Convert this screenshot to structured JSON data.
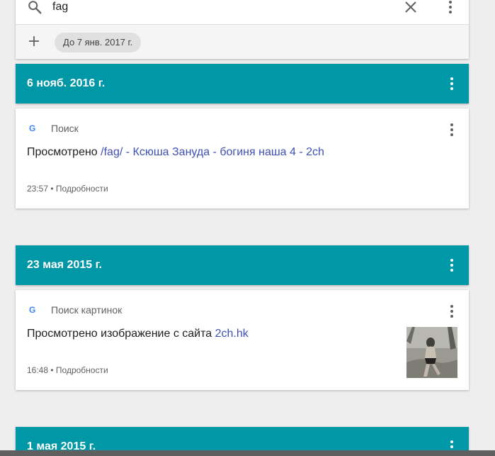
{
  "search": {
    "query": "fag",
    "filter_chip": "До 7 янв. 2017 г."
  },
  "groups": [
    {
      "date": "6 нояб. 2016 г.",
      "entry": {
        "source": "Поиск",
        "prefix": "Просмотрено ",
        "link": "/fag/ - Ксюша Зануда - богиня наша 4 - 2ch",
        "time": "23:57",
        "separator": " • ",
        "details": "Подробности"
      }
    },
    {
      "date": "23 мая 2015 г.",
      "entry": {
        "source": "Поиск картинок",
        "prefix": "Просмотрено изображение с сайта ",
        "link": "2ch.hk",
        "time": "16:48",
        "separator": " • ",
        "details": "Подробности"
      }
    },
    {
      "date": "1 мая 2015 г."
    }
  ],
  "colors": {
    "header_bg": "#0097a7",
    "link": "#3f51b5",
    "page_bg": "#eeeeee"
  },
  "icons": {
    "google": "G"
  }
}
